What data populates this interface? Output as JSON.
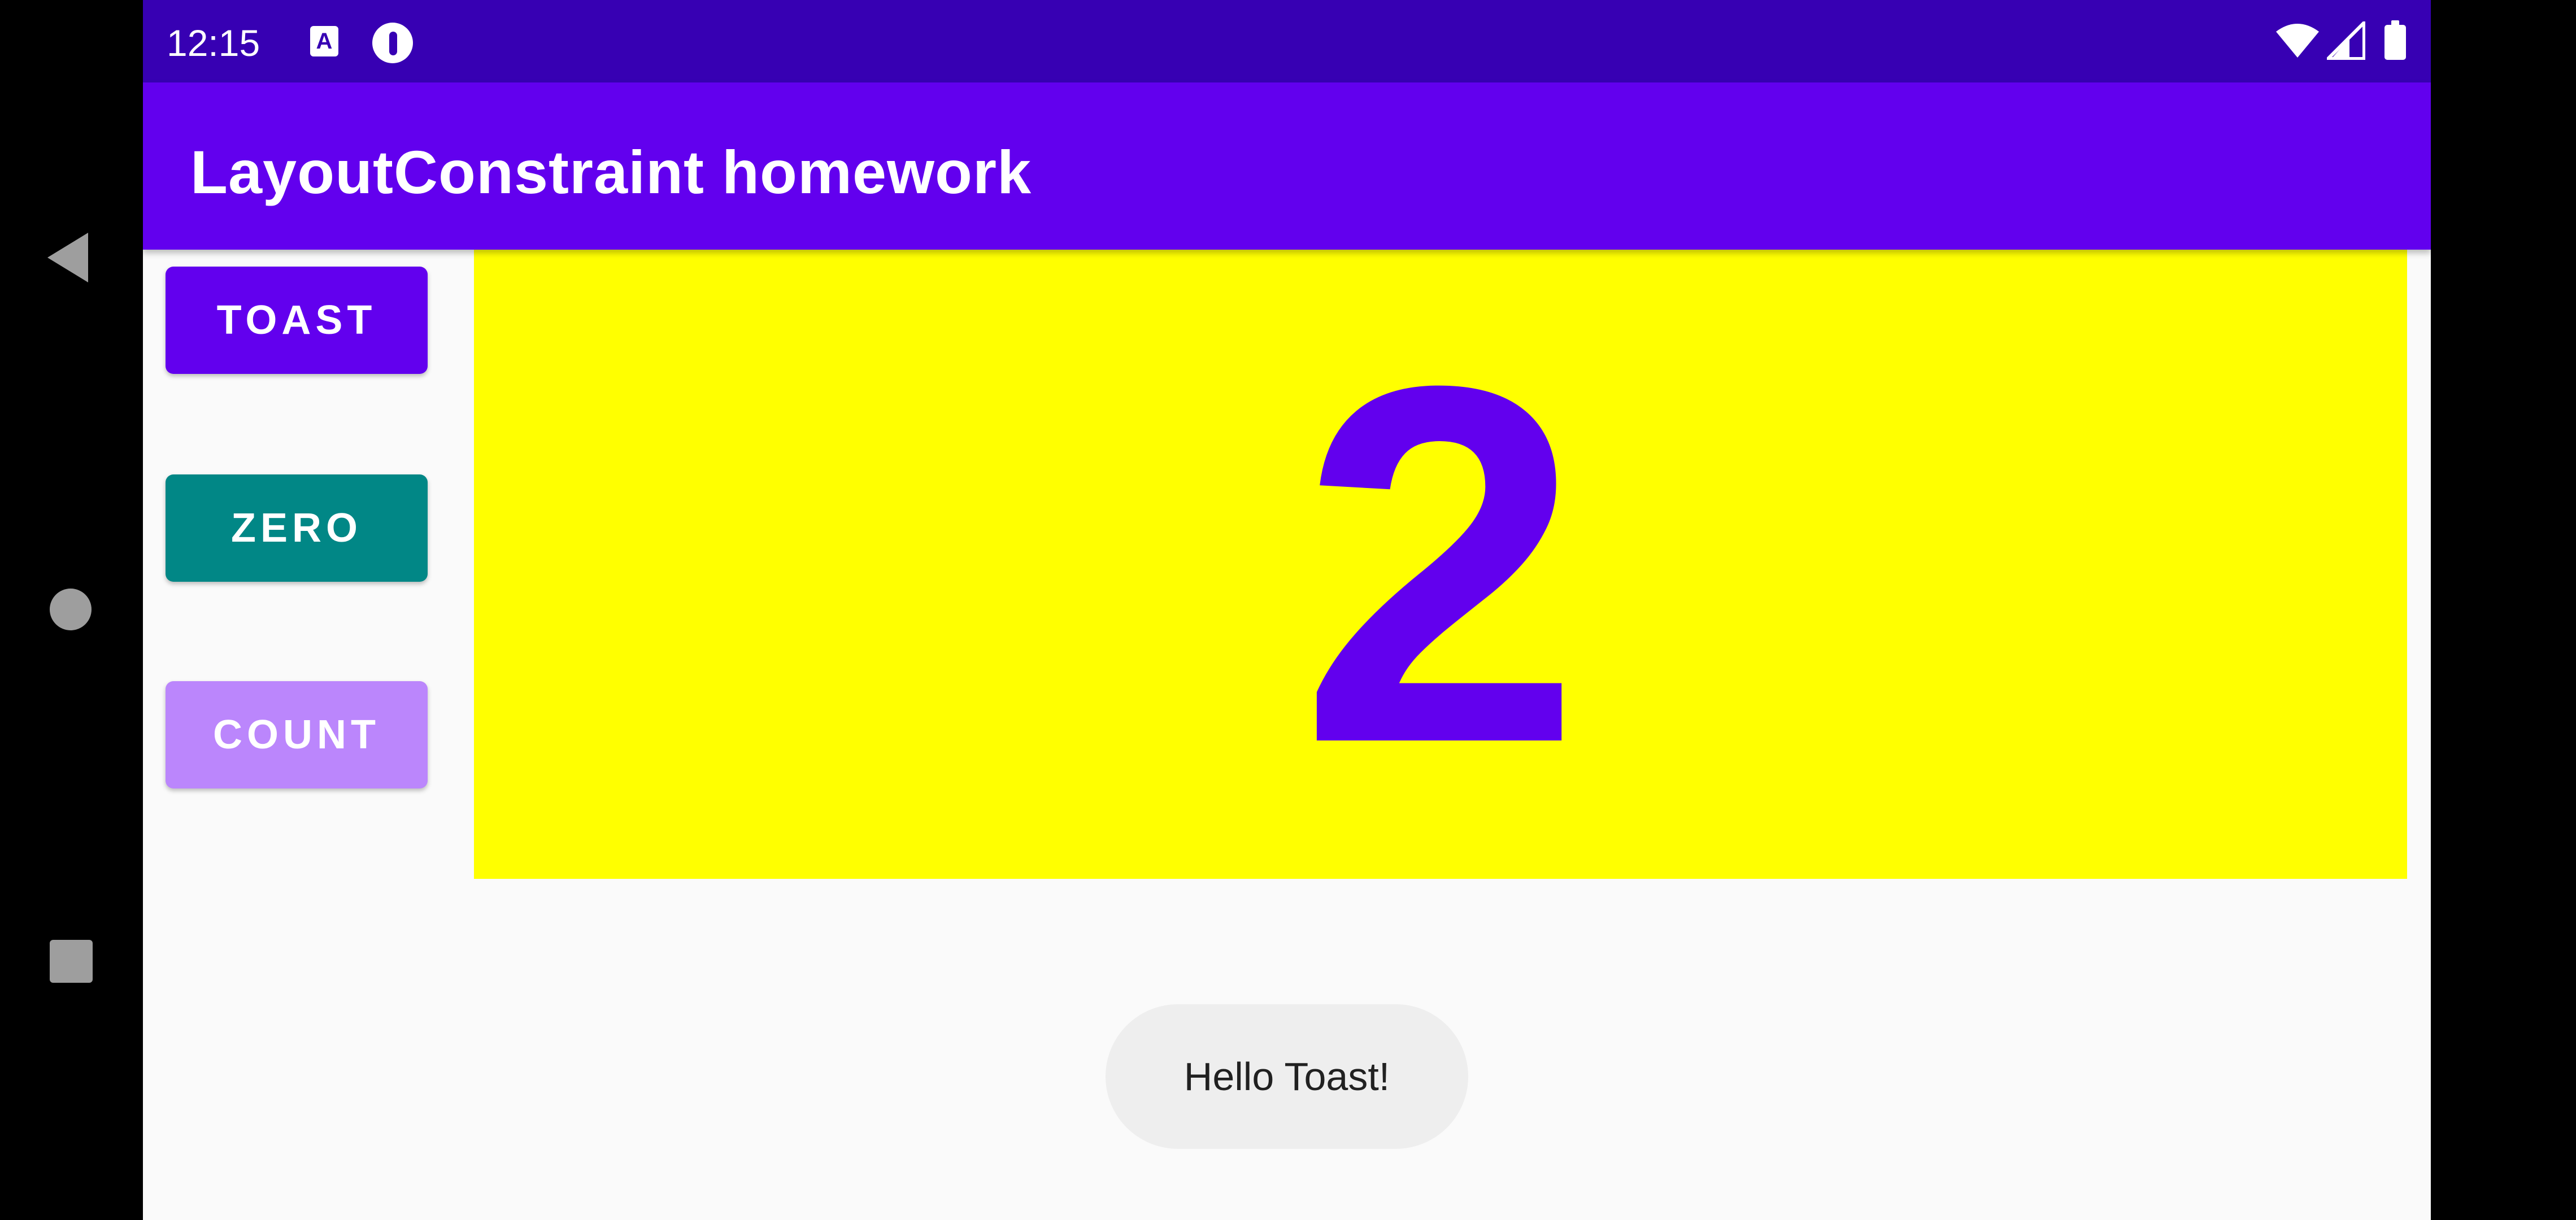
{
  "status_bar": {
    "time": "12:15",
    "notification_icons": [
      "translate-a-icon",
      "media-app-icon"
    ],
    "system_icons": [
      "wifi-icon",
      "signal-icon",
      "battery-icon"
    ]
  },
  "app_bar": {
    "title": "LayoutConstraint homework",
    "color": "#6200ee"
  },
  "buttons": {
    "toast": {
      "label": "TOAST",
      "color": "#6200ee"
    },
    "zero": {
      "label": "ZERO",
      "color": "#018786"
    },
    "count": {
      "label": "COUNT",
      "color": "#bb86fc"
    }
  },
  "counter": {
    "value": "2",
    "background": "#ffff00",
    "text_color": "#6200ee"
  },
  "toast_message": "Hello Toast!",
  "nav_bar": {
    "icons": [
      "back-icon",
      "home-icon",
      "recents-icon"
    ]
  }
}
